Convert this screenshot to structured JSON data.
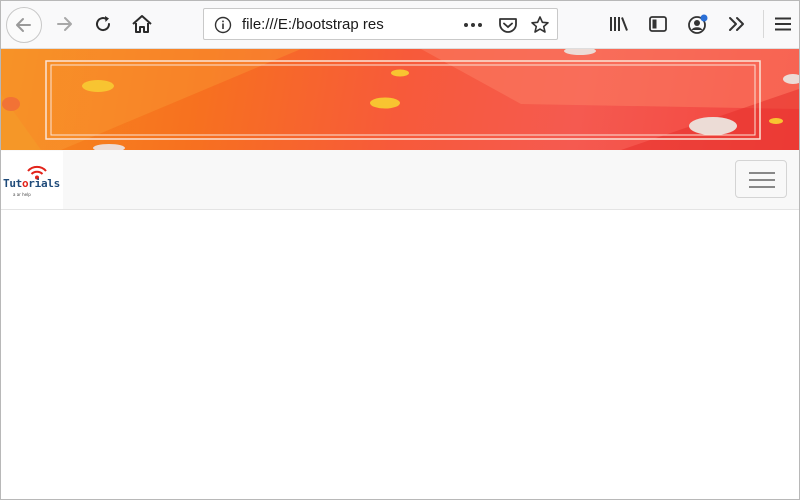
{
  "browser": {
    "url": "file:///E:/bootstrap responsive.html",
    "toolbar_icons": [
      "back-arrow-icon",
      "forward-arrow-icon",
      "reload-icon",
      "home-icon",
      "info-icon",
      "more-dots-icon",
      "pocket-icon",
      "bookmark-star-icon",
      "library-icon",
      "sidebar-icon",
      "account-icon",
      "overflow-chevrons-icon",
      "menu-icon"
    ]
  },
  "page": {
    "brand": {
      "name_parts": [
        "Tut",
        "o",
        "rials"
      ],
      "tagline": "a ar help"
    },
    "navbar_toggler_icon": "hamburger-icon",
    "colors": {
      "banner_start": "#f68a1e",
      "banner_end": "#f2443e",
      "navbar_bg": "#f8f8f8",
      "brand_accent": "#e2231a",
      "brand_text": "#1f4b7a"
    }
  }
}
